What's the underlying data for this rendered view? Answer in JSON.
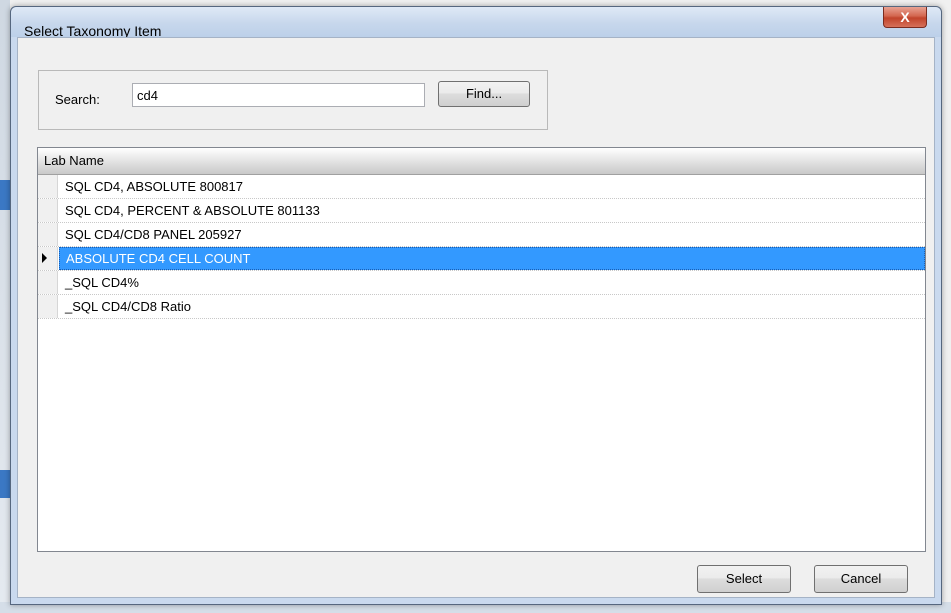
{
  "dialog": {
    "title": "Select Taxonomy Item",
    "close_glyph": "X"
  },
  "search": {
    "label": "Search:",
    "value": "cd4",
    "find_label": "Find..."
  },
  "grid": {
    "column_header": "Lab Name",
    "rows": [
      {
        "name": "SQL CD4, ABSOLUTE 800817",
        "selected": false
      },
      {
        "name": "SQL CD4, PERCENT & ABSOLUTE 801133",
        "selected": false
      },
      {
        "name": "SQL CD4/CD8 PANEL 205927",
        "selected": false
      },
      {
        "name": "ABSOLUTE CD4 CELL COUNT",
        "selected": true
      },
      {
        "name": "_SQL CD4%",
        "selected": false
      },
      {
        "name": "_SQL CD4/CD8 Ratio",
        "selected": false
      }
    ]
  },
  "footer": {
    "select_label": "Select",
    "cancel_label": "Cancel"
  },
  "colors": {
    "selection": "#3399ff",
    "close_button": "#c1432b"
  }
}
